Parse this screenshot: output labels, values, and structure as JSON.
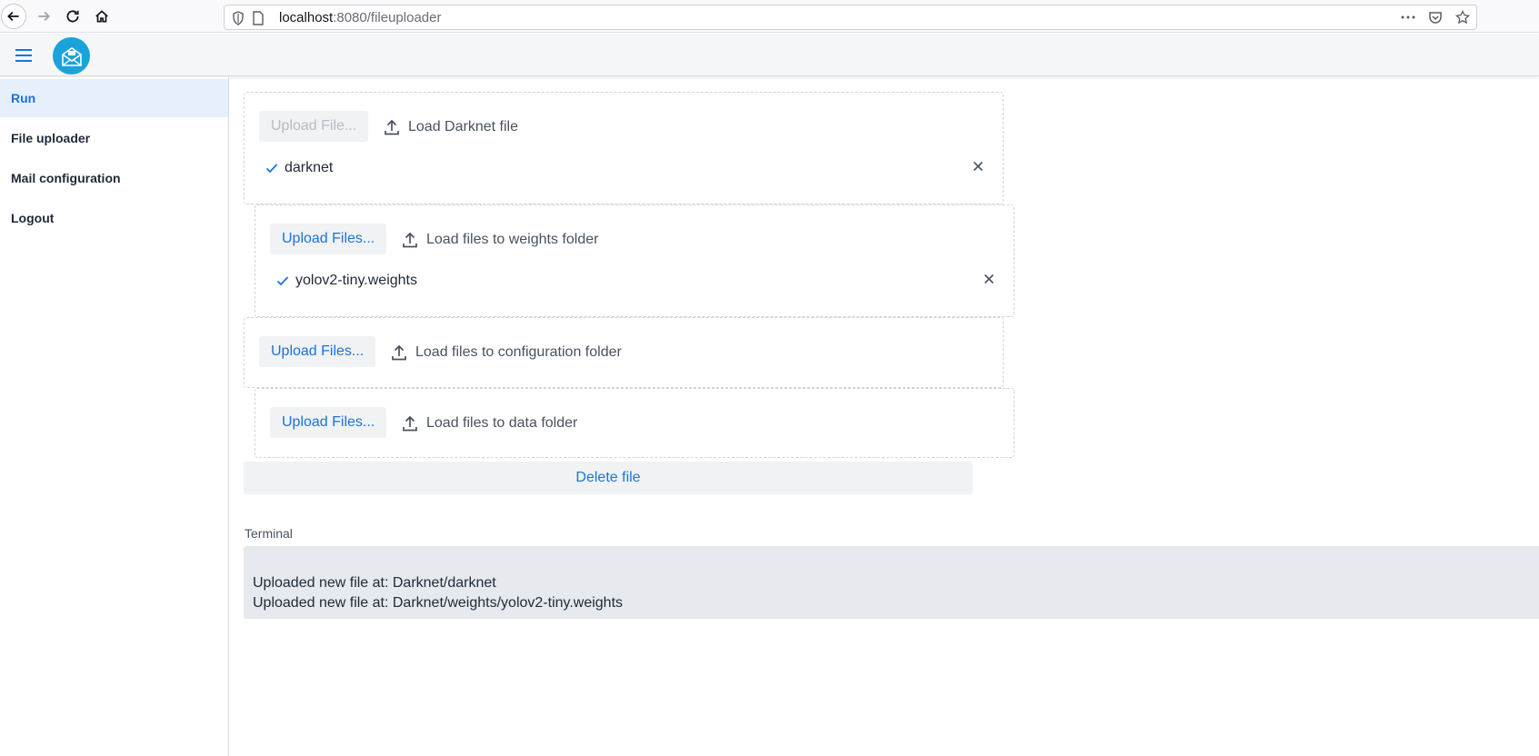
{
  "browser": {
    "url_host": "localhost",
    "url_rest": ":8080/fileuploader"
  },
  "sidebar": {
    "items": [
      {
        "label": "Run"
      },
      {
        "label": "File uploader"
      },
      {
        "label": "Mail configuration"
      },
      {
        "label": "Logout"
      }
    ]
  },
  "uploads": [
    {
      "button_label": "Upload File...",
      "drop_label": "Load Darknet file",
      "files": [
        "darknet"
      ]
    },
    {
      "button_label": "Upload Files...",
      "drop_label": "Load files to weights folder",
      "files": [
        "yolov2-tiny.weights"
      ]
    },
    {
      "button_label": "Upload Files...",
      "drop_label": "Load files to configuration folder",
      "files": []
    },
    {
      "button_label": "Upload Files...",
      "drop_label": "Load files to data folder",
      "files": []
    }
  ],
  "delete_button_label": "Delete file",
  "terminal": {
    "label": "Terminal",
    "lines": [
      "Uploaded new file at: Darknet/darknet",
      "Uploaded new file at: Darknet/weights/yolov2-tiny.weights"
    ]
  },
  "colors": {
    "accent": "#1a73d9",
    "logo_bg": "#1aa3d9",
    "sidebar_active_bg": "#e6f0fc",
    "terminal_bg": "#e6e9ed"
  }
}
